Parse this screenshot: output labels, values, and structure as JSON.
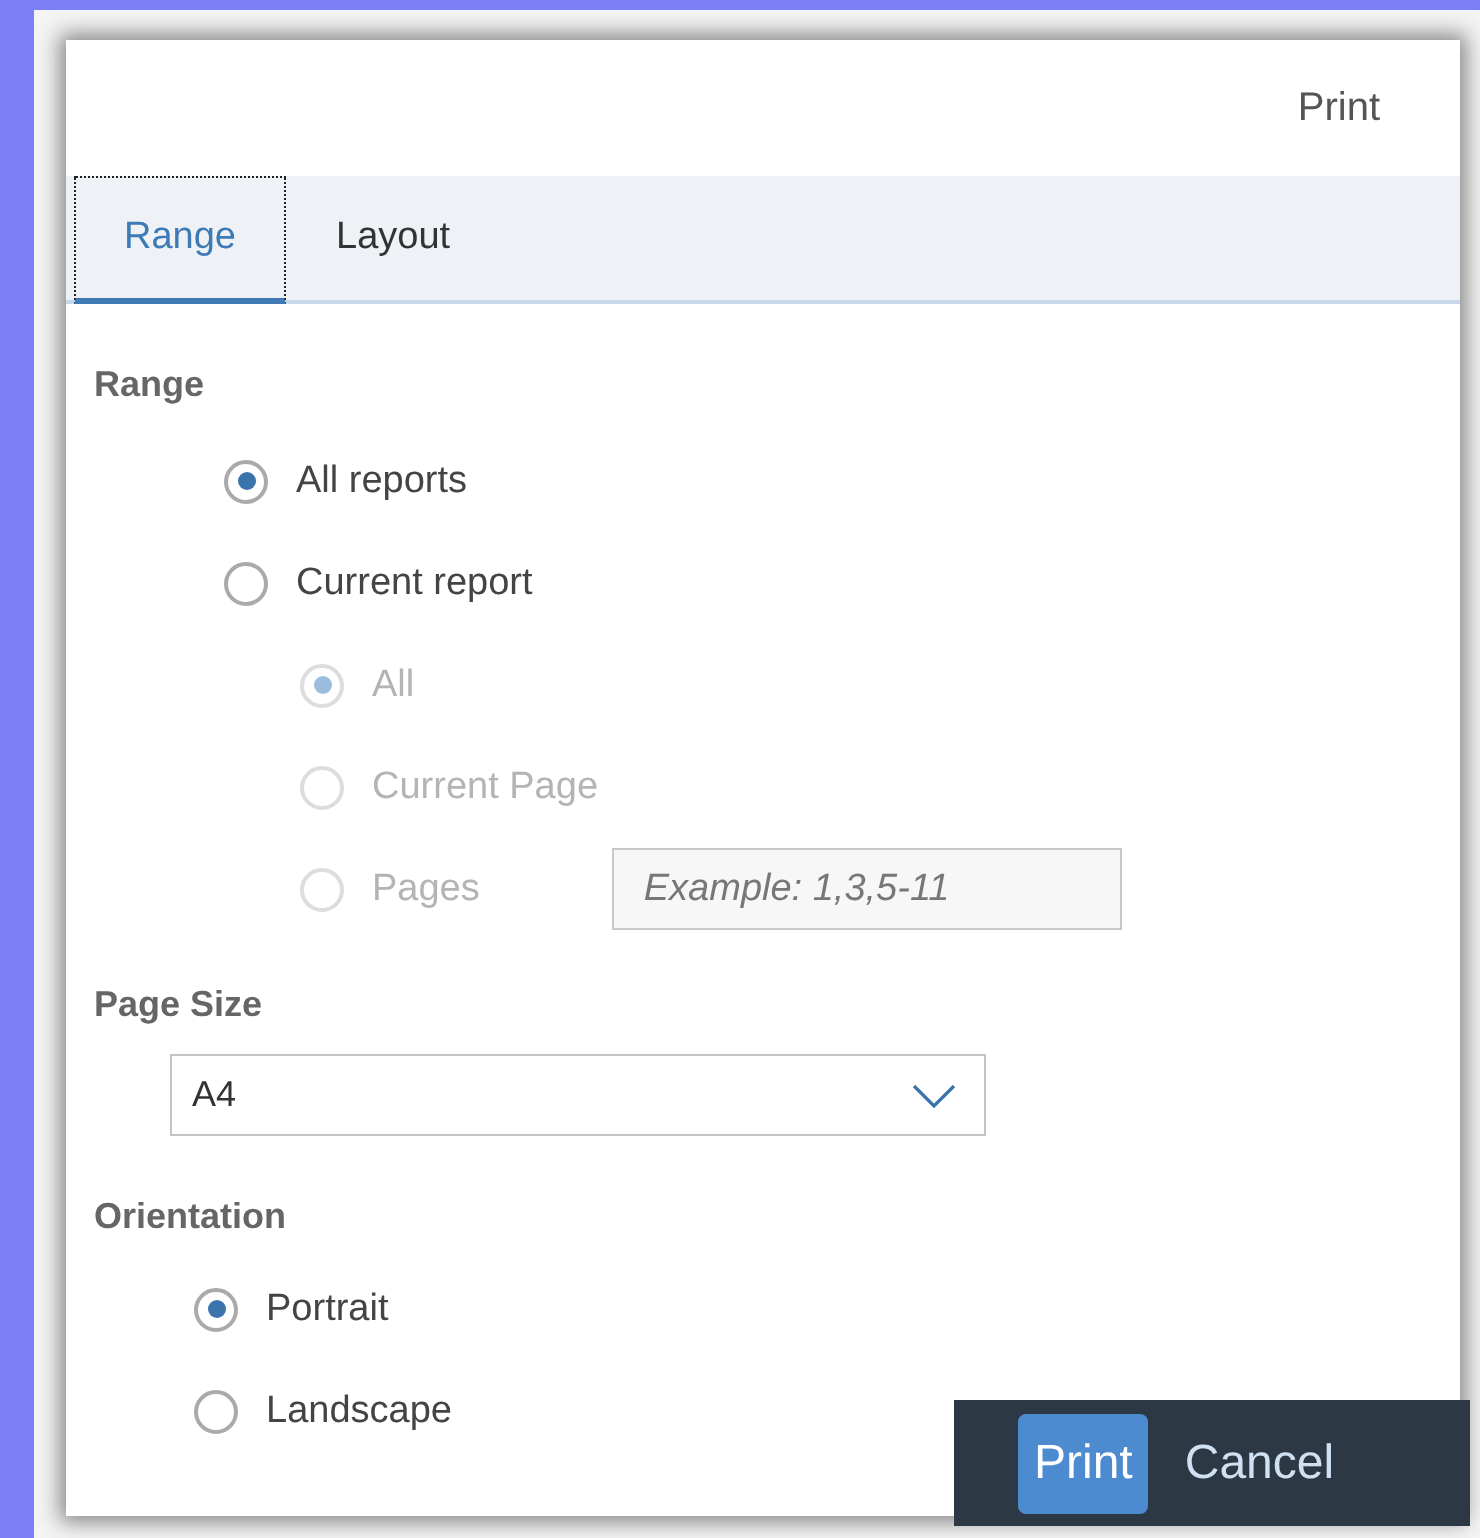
{
  "dialog": {
    "title": "Print"
  },
  "tabs": [
    {
      "label": "Range",
      "selected": true
    },
    {
      "label": "Layout",
      "selected": false
    }
  ],
  "range": {
    "heading": "Range",
    "options": [
      {
        "label": "All reports",
        "selected": true,
        "disabled": false
      },
      {
        "label": "Current report",
        "selected": false,
        "disabled": false,
        "children": [
          {
            "label": "All",
            "selected": true,
            "disabled": true
          },
          {
            "label": "Current Page",
            "selected": false,
            "disabled": true
          },
          {
            "label": "Pages",
            "selected": false,
            "disabled": true,
            "field": {
              "placeholder": "Example: 1,3,5-11"
            }
          }
        ]
      }
    ]
  },
  "page_size": {
    "heading": "Page Size",
    "value": "A4"
  },
  "orientation": {
    "heading": "Orientation",
    "options": [
      {
        "label": "Portrait",
        "selected": true,
        "disabled": false
      },
      {
        "label": "Landscape",
        "selected": false,
        "disabled": false
      }
    ]
  },
  "buttons": [
    {
      "label": "Print",
      "kind": "primary"
    },
    {
      "label": "Cancel",
      "kind": "plain"
    }
  ]
}
